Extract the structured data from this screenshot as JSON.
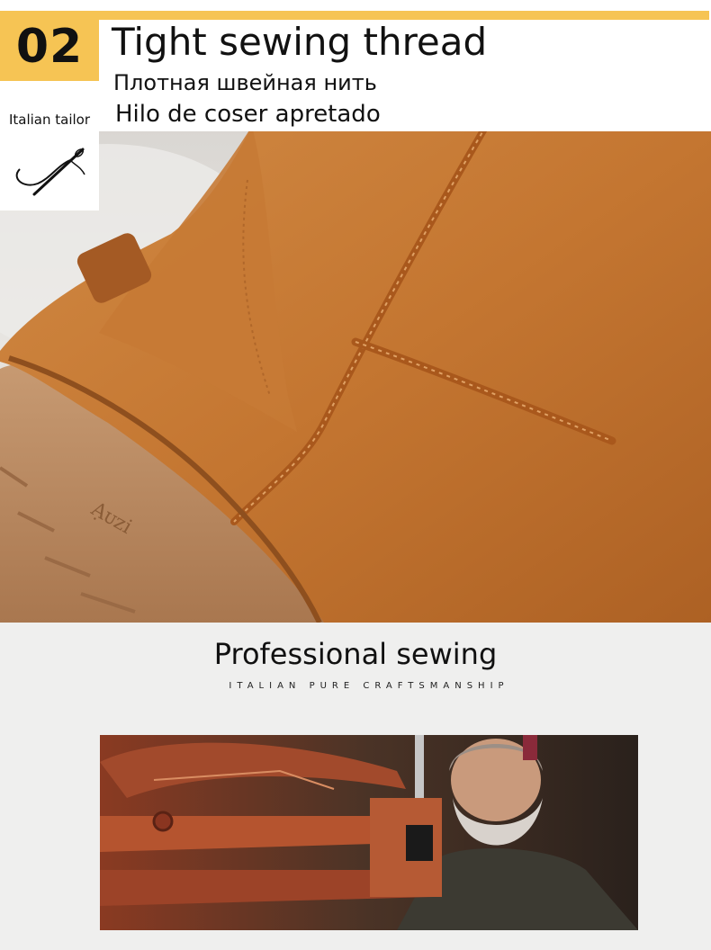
{
  "header": {
    "badge_number": "02",
    "tailor_label": "Italian tailor",
    "title_en": "Tight sewing thread",
    "title_ru": "Плотная швейная нить",
    "title_es": "Hilo de coser apretado"
  },
  "section": {
    "title": "Professional sewing",
    "subtitle": "ITALIAN PURE CRAFTSMANSHIP"
  },
  "icons": {
    "badge_icon": "needle-thread-icon"
  },
  "colors": {
    "accent": "#f6c454",
    "boot": "#c9782f",
    "background": "#efefee"
  }
}
